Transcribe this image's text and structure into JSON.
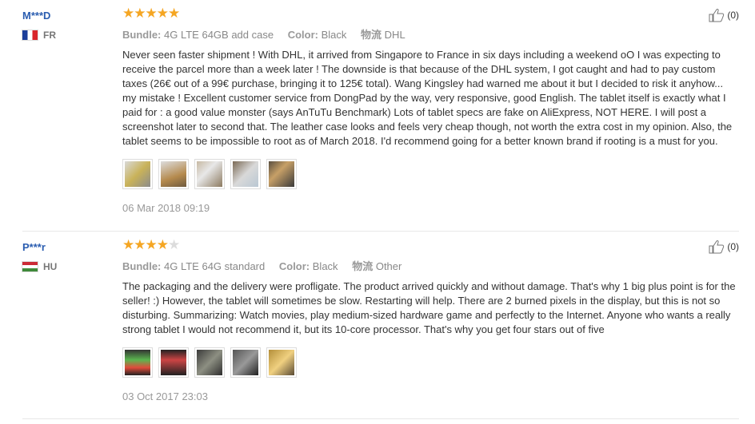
{
  "reviews": [
    {
      "user": "M***D",
      "country": "FR",
      "rating": 5,
      "bundle_label": "Bundle:",
      "bundle_value": "4G LTE 64GB add case",
      "color_label": "Color:",
      "color_value": "Black",
      "ship_label": "物流",
      "ship_value": "DHL",
      "text": "Never seen faster shipment ! With DHL, it arrived from Singapore to France in six days including a weekend oO I was expecting to receive the parcel more than a week later ! The downside is that because of the DHL system, I got caught and had to pay custom taxes (26€ out of a 99€ purchase, bringing it to 125€ total). Wang Kingsley had warned me about it but I decided to risk it anyhow... my mistake ! Excellent customer service from DongPad by the way, very responsive, good English. The tablet itself is exactly what I paid for : a good value monster (says AnTuTu Benchmark) Lots of tablet specs are fake on AliExpress, NOT HERE. I will post a screenshot later to second that. The leather case looks and feels very cheap though, not worth the extra cost in my opinion. Also, the tablet seems to be impossible to root as of March 2018. I'd recommend going for a better known brand if rooting is a must for you.",
      "date": "06 Mar 2018 09:19",
      "helpful": "(0)"
    },
    {
      "user": "P***r",
      "country": "HU",
      "rating": 4,
      "bundle_label": "Bundle:",
      "bundle_value": "4G LTE 64G standard",
      "color_label": "Color:",
      "color_value": "Black",
      "ship_label": "物流",
      "ship_value": "Other",
      "text": "The packaging and the delivery were profligate. The product arrived quickly and without damage. That's why 1 big plus point is for the seller! :) However, the tablet will sometimes be slow. Restarting will help. There are 2 burned pixels in the display, but this is not so disturbing. Summarizing: Watch movies, play medium-sized hardware game and perfectly to the Internet. Anyone who wants a really strong tablet I would not recommend it, but its 10-core processor. That's why you get four stars out of five",
      "date": "03 Oct 2017 23:03",
      "helpful": "(0)"
    }
  ],
  "icons": {
    "thumbs_up": "thumbs-up-icon",
    "star": "star-icon"
  },
  "colors": {
    "star": "#f5a623",
    "username": "#2a5db0"
  }
}
